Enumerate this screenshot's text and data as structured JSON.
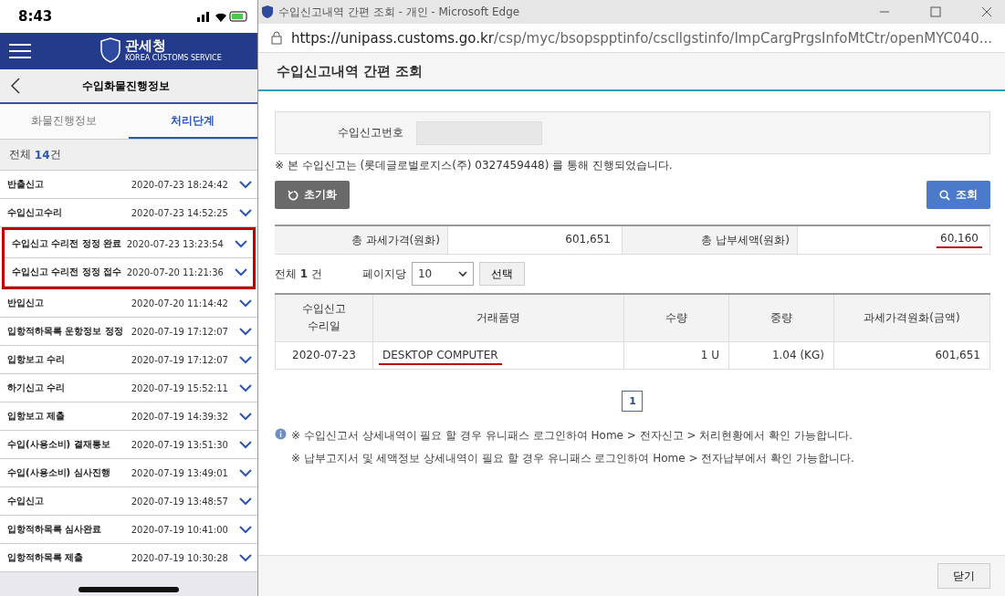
{
  "phone": {
    "status_bar": {
      "time": "8:43"
    },
    "header": {
      "logo_name": "관세청",
      "logo_subtitle": "KOREA CUSTOMS SERVICE"
    },
    "title": "수입화물진행정보",
    "tabs": [
      {
        "label": "화물진행정보",
        "selected": false
      },
      {
        "label": "처리단계",
        "selected": true
      }
    ],
    "total": {
      "label": "전체",
      "count": "14",
      "unit": "건"
    },
    "rows": [
      {
        "name": "반출신고",
        "time": "2020-07-23 18:24:42",
        "highlighted": false
      },
      {
        "name": "수입신고수리",
        "time": "2020-07-23 14:52:25",
        "highlighted": false
      },
      {
        "name": "수입신고 수리전 정정 완료",
        "time": "2020-07-23 13:23:54",
        "highlighted": true
      },
      {
        "name": "수입신고 수리전 정정 접수",
        "time": "2020-07-20 11:21:36",
        "highlighted": true
      },
      {
        "name": "반입신고",
        "time": "2020-07-20 11:14:42",
        "highlighted": false
      },
      {
        "name": "입항적하목록 운항정보 정정",
        "time": "2020-07-19 17:12:07",
        "highlighted": false
      },
      {
        "name": "입항보고 수리",
        "time": "2020-07-19 17:12:07",
        "highlighted": false
      },
      {
        "name": "하기신고 수리",
        "time": "2020-07-19 15:52:11",
        "highlighted": false
      },
      {
        "name": "입항보고 제출",
        "time": "2020-07-19 14:39:32",
        "highlighted": false
      },
      {
        "name": "수입(사용소비) 결재통보",
        "time": "2020-07-19 13:51:30",
        "highlighted": false
      },
      {
        "name": "수입(사용소비) 심사진행",
        "time": "2020-07-19 13:49:01",
        "highlighted": false
      },
      {
        "name": "수입신고",
        "time": "2020-07-19 13:48:57",
        "highlighted": false
      },
      {
        "name": "입항적하목록 심사완료",
        "time": "2020-07-19 10:41:00",
        "highlighted": false
      },
      {
        "name": "입항적하목록 제출",
        "time": "2020-07-19 10:30:28",
        "highlighted": false
      }
    ]
  },
  "browser": {
    "window": {
      "title": "수입신고내역 간편 조회 - 개인 - Microsoft Edge"
    },
    "address_bar": {
      "host": "https://unipass.customs.go.kr",
      "path": "/csp/myc/bsopspptinfo/cscllgstinfo/ImpCargPrgsInfoMtCtr/openMYC040..."
    },
    "page_title": "수입신고내역 간편 조회",
    "form": {
      "label": "수입신고번호"
    },
    "notice": "※ 본 수입신고는 (롯데글로벌로지스(주) 0327459448) 를 통해 진행되었습니다.",
    "buttons": {
      "reset": "초기화",
      "search": "조회"
    },
    "summary": [
      {
        "label": "총 과세가격(원화)",
        "value": "601,651",
        "underlined": false
      },
      {
        "label": "총 납부세액(원화)",
        "value": "60,160",
        "underlined": true
      }
    ],
    "list_info": {
      "total_label": "전체",
      "total_count": "1",
      "total_unit": "건",
      "per_page_label": "페이지당",
      "per_page": "10",
      "select_button": "선택"
    },
    "table": {
      "columns": [
        "수입신고\n수리일",
        "거래품명",
        "수량",
        "중량",
        "과세가격원화(금액)"
      ],
      "rows": [
        [
          {
            "text": "2020-07-23",
            "underlined": false
          },
          {
            "text": "DESKTOP COMPUTER",
            "underlined": true
          },
          {
            "text": "1 U",
            "underlined": false
          },
          {
            "text": "1.04 (KG)",
            "underlined": false
          },
          {
            "text": "601,651",
            "underlined": false
          }
        ]
      ]
    },
    "pagination": [
      {
        "label": "1",
        "selected": true
      }
    ],
    "info_notes": [
      "※ 수입신고서 상세내역이 필요 할 경우 유니패스 로그인하여 Home > 전자신고 > 처리현황에서 확인 가능합니다.",
      "※ 납부고지서 및 세액정보 상세내역이 필요 할 경우 유니패스 로그인하여 Home > 전자납부에서 확인 가능합니다."
    ],
    "close_button": "닫기"
  }
}
